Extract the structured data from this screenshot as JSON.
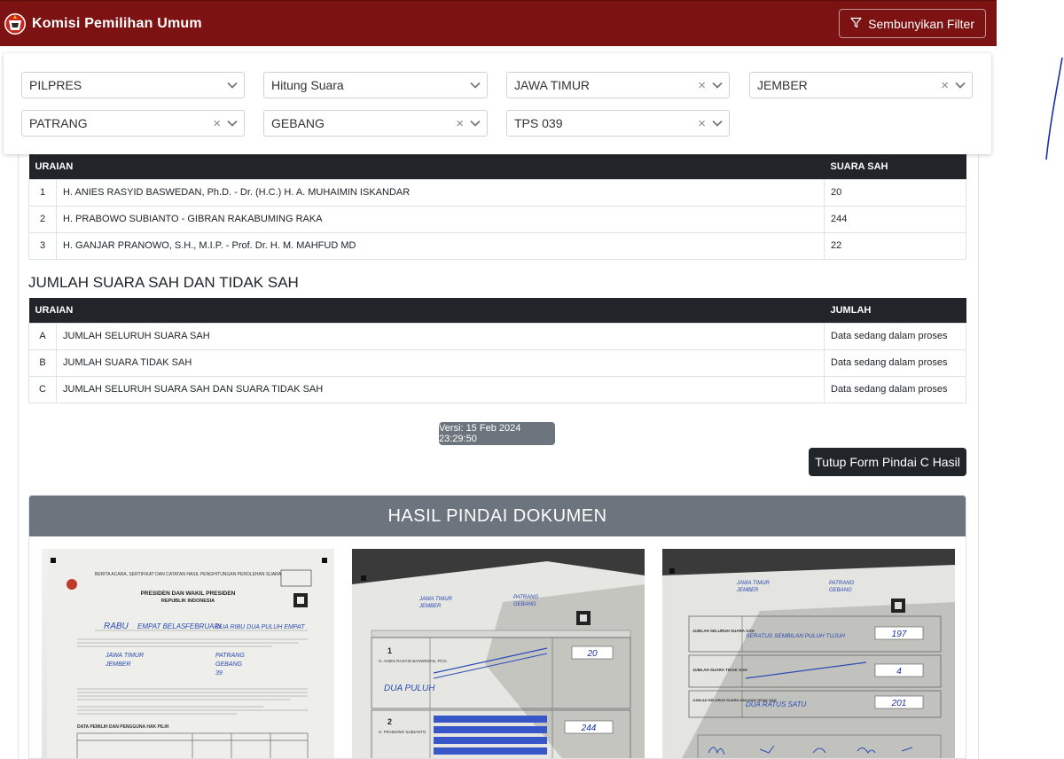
{
  "app": {
    "title": "Komisi Pemilihan Umum",
    "filter_button_label": "Sembunyikan Filter"
  },
  "filters": {
    "election": "PILPRES",
    "mode": "Hitung Suara",
    "province": "JAWA TIMUR",
    "regency": "JEMBER",
    "district": "PATRANG",
    "village": "GEBANG",
    "tps": "TPS 039"
  },
  "candidates_table": {
    "headers": [
      "URAIAN",
      "SUARA SAH"
    ],
    "rows": [
      {
        "no": "1",
        "name": "H. ANIES RASYID BASWEDAN, Ph.D. - Dr. (H.C.) H. A. MUHAIMIN ISKANDAR",
        "votes": "20"
      },
      {
        "no": "2",
        "name": "H. PRABOWO SUBIANTO - GIBRAN RAKABUMING RAKA",
        "votes": "244"
      },
      {
        "no": "3",
        "name": "H. GANJAR PRANOWO, S.H., M.I.P. - Prof. Dr. H. M. MAHFUD MD",
        "votes": "22"
      }
    ]
  },
  "summary": {
    "title": "JUMLAH SUARA SAH DAN TIDAK SAH",
    "headers": [
      "URAIAN",
      "JUMLAH"
    ],
    "rows": [
      {
        "no": "A",
        "label": "JUMLAH SELURUH SUARA SAH",
        "value": "Data sedang dalam proses"
      },
      {
        "no": "B",
        "label": "JUMLAH SUARA TIDAK SAH",
        "value": "Data sedang dalam proses"
      },
      {
        "no": "C",
        "label": "JUMLAH SELURUH SUARA SAH DAN SUARA TIDAK SAH",
        "value": "Data sedang dalam proses"
      }
    ]
  },
  "version_label": "Versi: 15 Feb 2024 23:29:50",
  "close_form_label": "Tutup Form Pindai C Hasil",
  "scan": {
    "title": "HASIL PINDAI DOKUMEN",
    "page1": {
      "heading1": "BERITA ACARA, SERTIFIKAT DAN CATATAN HASIL PENGHITUNGAN PEROLEHAN SUARA",
      "heading2": "PRESIDEN DAN WAKIL PRESIDEN",
      "heading3": "REPUBLIK INDONESIA",
      "handwriting_day": "RABU",
      "handwriting_date": "EMPAT BELAS",
      "handwriting_month": "FEBRUARI",
      "handwriting_year": "DUA RIBU DUA PULUH EMPAT",
      "province": "JAWA TIMUR",
      "regency": "JEMBER",
      "district": "PATRANG",
      "village": "GEBANG",
      "tps_no": "39",
      "section": "DATA PEMILIH DAN PENGGUNA HAK PILIH"
    },
    "page2": {
      "province": "JAWA TIMUR",
      "regency": "JEMBER",
      "district": "PATRANG",
      "village": "GEBANG",
      "cand1_no": "1",
      "cand1_name": "H. ANIES RASYID BASWEDAN, Ph.D.",
      "cand1_words": "DUA PULUH",
      "cand1_digits": "20",
      "cand2_no": "2",
      "cand2_name": "H. PRABOWO SUBIANTO",
      "cand2_digits": "244"
    },
    "page3": {
      "province": "JAWA TIMUR",
      "regency": "JEMBER",
      "district": "PATRANG",
      "village": "GEBANG",
      "section1": "JUMLAH SELURUH SUARA SAH",
      "total_words": "SERATUS SEMBILAN PULUH TUJUH",
      "total_digits": "197",
      "section2": "JUMLAH SUARA TIDAK SAH",
      "invalid_digits": "4",
      "section3": "JUMLAH SELURUH SUARA SAH DAN TIDAK SAH",
      "grand_words": "DUA RATUS SATU",
      "grand_digits": "201"
    }
  },
  "colors": {
    "navbar": "#7c1212",
    "table_header": "#212529",
    "badge": "#6c757d",
    "scan_header": "#6c757d"
  }
}
